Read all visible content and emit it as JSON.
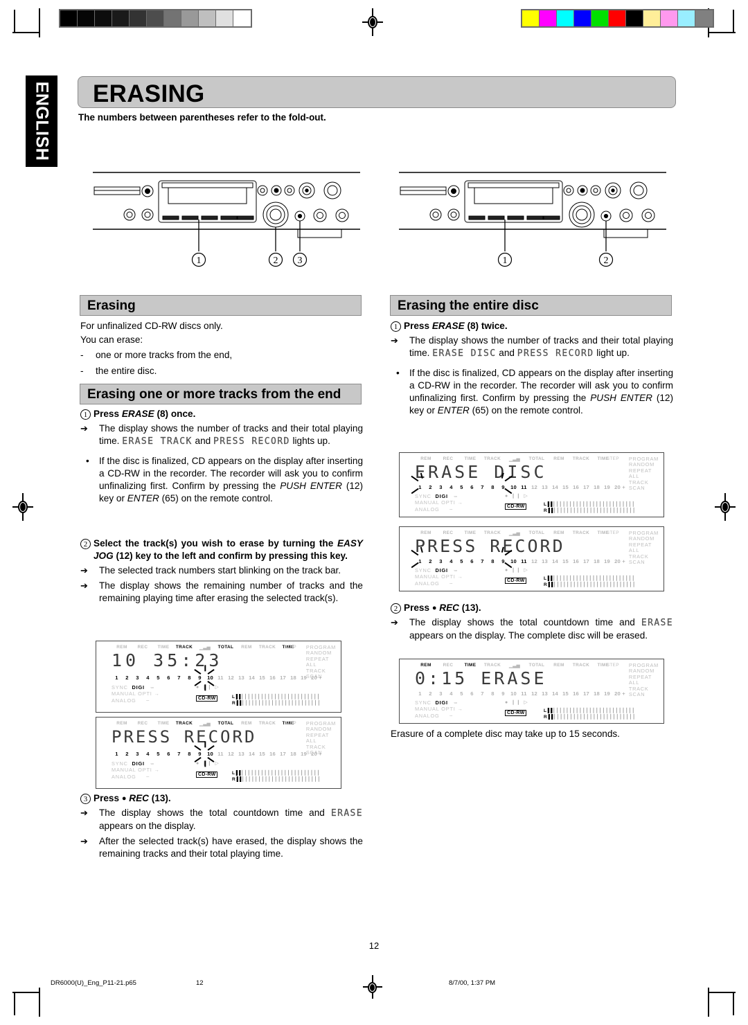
{
  "language_tab": "ENGLISH",
  "chapter": {
    "title": "ERASING",
    "foldout_note": "The numbers between parentheses refer to the fold-out."
  },
  "diagrams": {
    "left": {
      "callouts": [
        "1",
        "2",
        "3"
      ]
    },
    "right": {
      "callouts": [
        "1",
        "2"
      ]
    }
  },
  "left_column": {
    "section_erasing": {
      "heading": "Erasing",
      "line1": "For unfinalized CD-RW discs only.",
      "line2": "You can erase:",
      "bullets": [
        {
          "mark": "-",
          "text": "one or more tracks from the end,"
        },
        {
          "mark": "-",
          "text": "the entire disc."
        }
      ]
    },
    "section_tracks": {
      "heading": "Erasing one or more tracks from the end",
      "step1": {
        "num": "1",
        "title_pre": "Press ",
        "title_em": "ERASE",
        "title_post": " (8) once.",
        "arrow1_a": "The display shows the number of tracks and their total playing time. ",
        "arrow1_lcd1": "ERASE TRACK",
        "arrow1_mid": " and ",
        "arrow1_lcd2": "PRESS RECORD",
        "arrow1_b": " lights up.",
        "bullet1": "If the disc is finalized, CD appears on the display after inserting a CD-RW in the recorder. The recorder will ask you to confirm unfinalizing first. Confirm by pressing the ",
        "bullet1_em1": "PUSH ENTER",
        "bullet1_mid": " (12) key or ",
        "bullet1_em2": "ENTER",
        "bullet1_end": " (65) on the remote control."
      },
      "step2": {
        "num": "2",
        "title_pre": "Select the track(s) you wish to erase by turning the ",
        "title_em": "EASY JOG",
        "title_post": " (12) key to the left and confirm by pressing this key.",
        "arrow1": "The selected track numbers start blinking on the track bar.",
        "arrow2": "The display shows the remaining number of tracks and the remaining playing time after erasing the selected track(s)."
      },
      "step3": {
        "num": "3",
        "title_pre": "Press ",
        "title_dot": "●",
        "title_em": " REC",
        "title_post": " (13).",
        "arrow1_a": "The display shows the total countdown time and ",
        "arrow1_lcd": "ERASE",
        "arrow1_b": " appears on the display.",
        "arrow2": "After the selected track(s) have erased, the display shows the remaining tracks and their total playing time."
      }
    }
  },
  "right_column": {
    "section_disc": {
      "heading": "Erasing the entire disc",
      "step1": {
        "num": "1",
        "title_pre": "Press ",
        "title_em": "ERASE",
        "title_post": " (8) twice.",
        "arrow1_a": "The display shows the number of tracks and their total playing time. ",
        "arrow1_lcd1": "ERASE DISC",
        "arrow1_mid": " and ",
        "arrow1_lcd2": "PRESS RECORD",
        "arrow1_b": " light up.",
        "bullet1": "If the disc is finalized, CD appears on the display after inserting a CD-RW in the recorder. The recorder will ask you to confirm unfinalizing first. Confirm by pressing the ",
        "bullet1_em1": "PUSH ENTER",
        "bullet1_mid": " (12) key or ",
        "bullet1_em2": "ENTER",
        "bullet1_end": " (65) on the remote control."
      },
      "step2": {
        "num": "2",
        "title_pre": "Press ",
        "title_dot": "●",
        "title_em": " REC",
        "title_post": " (13).",
        "arrow1_a": "The display shows the total countdown time and ",
        "arrow1_lcd": "ERASE",
        "arrow1_b": " appears on the display. The complete disc will be erased."
      }
    },
    "bottom_note": "Erasure of a complete disc may take up to 15 seconds."
  },
  "lcd_panels": {
    "track_count": {
      "flags": [
        "REM",
        "REC",
        "TIME",
        "TRACK",
        "TOTAL",
        "REM",
        "TRACK",
        "TIME"
      ],
      "active_flags": [
        "TRACK",
        "TOTAL",
        "TIME"
      ],
      "main_text": "10  35:23",
      "track_numbers": [
        "1",
        "2",
        "3",
        "4",
        "5",
        "6",
        "7",
        "8",
        "9",
        "10",
        "11",
        "12",
        "13",
        "14",
        "15",
        "16",
        "17",
        "18",
        "19",
        "20 +"
      ],
      "blinking_track": "10",
      "modes": [
        "PROGRAM",
        "RANDOM",
        "REPEAT",
        "ALL",
        "TRACK",
        "SCAN"
      ],
      "step_label": "STEP",
      "input_labels": [
        "SYNC",
        "DIGI",
        "MANUAL OPTI",
        "ANALOG"
      ],
      "active_input": "DIGI",
      "disc_type": "CD-RW",
      "vu_left": "L",
      "vu_right": "R"
    },
    "press_record_left": {
      "main_text": "PRESS RECORD",
      "blinking_track": "10"
    },
    "erase_disc": {
      "main_text": "ERASE DISC",
      "blinking_tracks": "1-11"
    },
    "press_record_right": {
      "main_text": "PRESS RECORD",
      "blinking_tracks": "1-11"
    },
    "countdown": {
      "main_text": "0:15 ERASE",
      "active_flags": [
        "REM",
        "TIME"
      ]
    }
  },
  "page_number": "12",
  "footer": {
    "file": "DR6000(U)_Eng_P11-21.p65",
    "page": "12",
    "date": "8/7/00, 1:37 PM"
  },
  "reg_marks": {
    "gray_wedge": [
      "#000000",
      "#060606",
      "#0d0d0d",
      "#1a1a1a",
      "#333333",
      "#4d4d4d",
      "#737373",
      "#999999",
      "#bfbfbf",
      "#e0e0e0",
      "#ffffff"
    ],
    "color_bars": [
      "#ffff00",
      "#ff00ff",
      "#00ffff",
      "#0000ff",
      "#00e000",
      "#ff0000",
      "#000000",
      "#ffee99",
      "#ff99ee",
      "#99eeff",
      "#808080"
    ]
  }
}
